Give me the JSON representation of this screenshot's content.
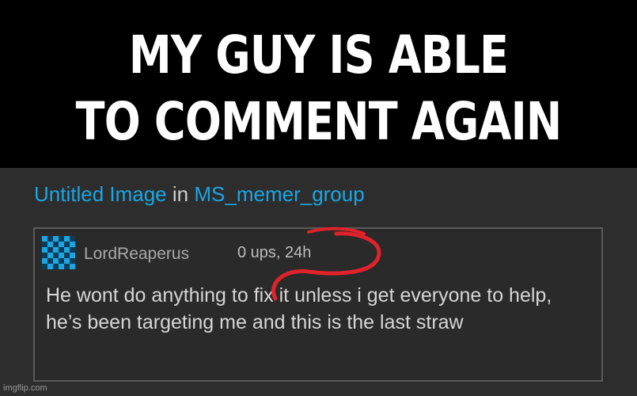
{
  "caption": {
    "line1": "MY GUY IS ABLE",
    "line2": "TO COMMENT AGAIN"
  },
  "post": {
    "image_title": "Untitled Image",
    "in_label": "in",
    "stream_name": "MS_memer_group"
  },
  "comment": {
    "username": "LordReaperus",
    "meta": "0 ups, 24h",
    "text": "He wont do anything to fix it unless i get everyone to help, he’s been targeting me and this is the last straw"
  },
  "colors": {
    "link": "#1aa6e4",
    "annotation": "#e0222a"
  },
  "avatar_icon": "checkered-avatar-icon",
  "watermark": "imgflip.com"
}
